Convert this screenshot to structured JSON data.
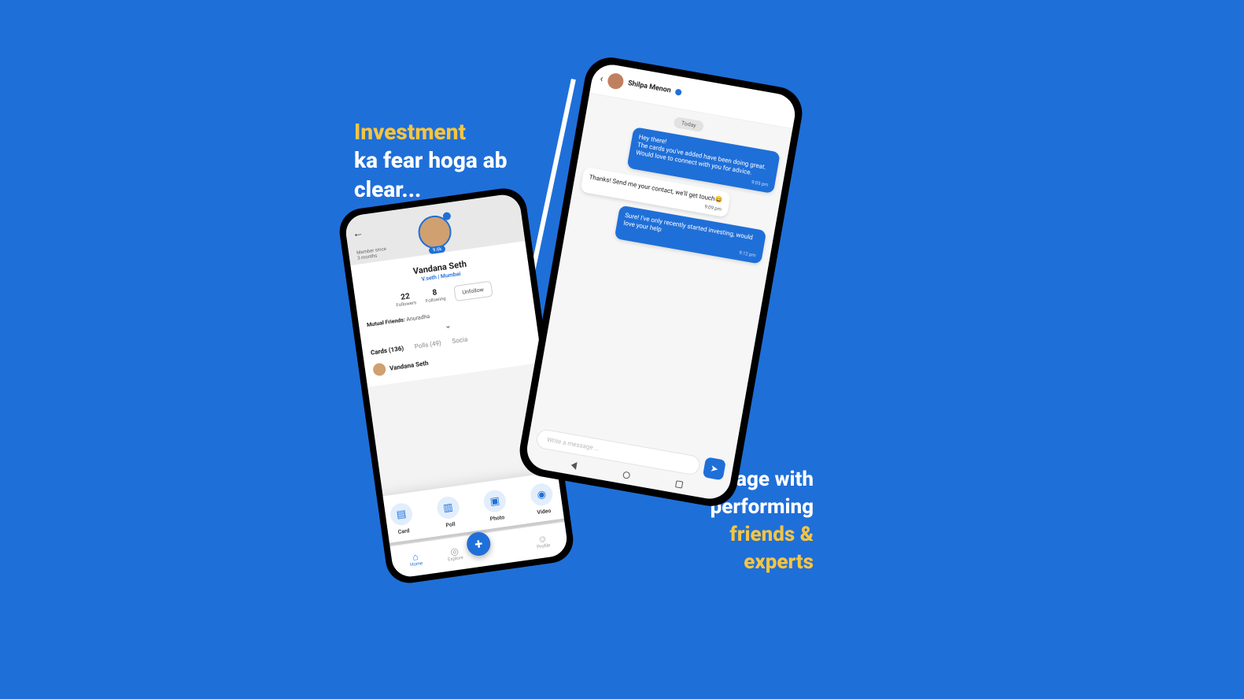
{
  "tagline_left": {
    "line1": "Investment",
    "line2": "ka fear hoga ab",
    "line3": "clear..."
  },
  "tagline_right": {
    "line1": "Engage with",
    "line2": "performing",
    "line3": "friends &",
    "line4": "experts"
  },
  "profile": {
    "member_since_label": "Member since",
    "member_since_value": "3 months",
    "follower_badge": "9.6k",
    "name": "Vandana Seth",
    "handle": "V.seth | Mumbai",
    "followers_count": "22",
    "followers_label": "Followers",
    "following_count": "8",
    "following_label": "Following",
    "unfollow": "Unfollow",
    "mutual_label": "Mutual Friends:",
    "mutual_value": "Anuradha",
    "tabs": {
      "cards": "Cards (136)",
      "polls": "Polls (49)",
      "social": "Socia"
    },
    "feed_name": "Vandana Seth"
  },
  "compose": {
    "card": "Card",
    "poll": "Poll",
    "photo": "Photo",
    "video": "Video"
  },
  "nav": {
    "home": "Home",
    "explore": "Explore",
    "profile": "Profile"
  },
  "chat": {
    "contact": "Shilpa Menon",
    "day": "Today",
    "m1": "Hey there!\nThe cards you've added have been doing great.\nWould love to connect with you for advice.",
    "t1": "9:05 pm",
    "m2": "Thanks! Send me your contact, we'll get touch😄",
    "t2": "9:09 pm",
    "m3": "Sure! I've only recently started investing, would love your help",
    "t3": "9:12 pm",
    "placeholder": "Write a message ..."
  }
}
